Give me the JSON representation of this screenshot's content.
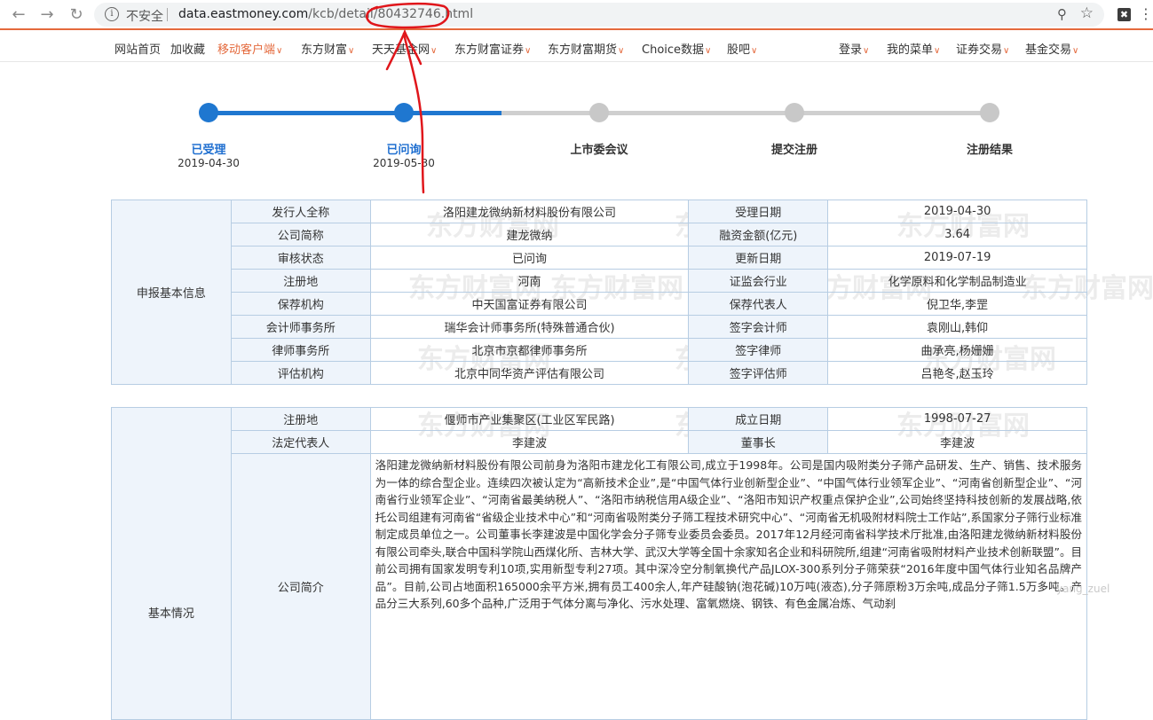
{
  "browser": {
    "insecure_label": "不安全",
    "url_host": "data.eastmoney.com",
    "url_path": "/kcb/detail/80432746.html"
  },
  "topnav": [
    {
      "label": "网站首页",
      "hl": false,
      "caret": false
    },
    {
      "label": "加收藏",
      "hl": false,
      "caret": false
    },
    {
      "label": "移动客户端",
      "hl": true,
      "caret": true
    },
    {
      "label": "东方财富",
      "hl": false,
      "caret": true
    },
    {
      "label": "天天基金网",
      "hl": false,
      "caret": true
    },
    {
      "label": "东方财富证券",
      "hl": false,
      "caret": true
    },
    {
      "label": "东方财富期货",
      "hl": false,
      "caret": true
    },
    {
      "label": "Choice数据",
      "hl": false,
      "caret": true
    },
    {
      "label": "股吧",
      "hl": false,
      "caret": true
    },
    {
      "label": "登录",
      "hl": false,
      "caret": true
    },
    {
      "label": "我的菜单",
      "hl": false,
      "caret": true
    },
    {
      "label": "证券交易",
      "hl": false,
      "caret": true
    },
    {
      "label": "基金交易",
      "hl": false,
      "caret": true
    }
  ],
  "steps": [
    {
      "label": "已受理",
      "date": "2019-04-30",
      "done": true
    },
    {
      "label": "已问询",
      "date": "2019-05-30",
      "done": true
    },
    {
      "label": "上市委会议",
      "date": "",
      "done": false
    },
    {
      "label": "提交注册",
      "date": "",
      "done": false
    },
    {
      "label": "注册结果",
      "date": "",
      "done": false
    }
  ],
  "basic_info": {
    "section": "申报基本信息",
    "rows": [
      [
        "发行人全称",
        "洛阳建龙微纳新材料股份有限公司",
        "受理日期",
        "2019-04-30"
      ],
      [
        "公司简称",
        "建龙微纳",
        "融资金额(亿元)",
        "3.64"
      ],
      [
        "审核状态",
        "已问询",
        "更新日期",
        "2019-07-19"
      ],
      [
        "注册地",
        "河南",
        "证监会行业",
        "化学原料和化学制品制造业"
      ],
      [
        "保荐机构",
        "中天国富证券有限公司",
        "保荐代表人",
        "倪卫华,李罡"
      ],
      [
        "会计师事务所",
        "瑞华会计师事务所(特殊普通合伙)",
        "签字会计师",
        "袁刚山,韩仰"
      ],
      [
        "律师事务所",
        "北京市京都律师事务所",
        "签字律师",
        "曲承亮,杨姗姗"
      ],
      [
        "评估机构",
        "北京中同华资产评估有限公司",
        "签字评估师",
        "吕艳冬,赵玉玲"
      ]
    ]
  },
  "company": {
    "section": "基本情况",
    "rows": [
      [
        "注册地",
        "偃师市产业集聚区(工业区军民路)",
        "成立日期",
        "1998-07-27"
      ],
      [
        "法定代表人",
        "李建波",
        "董事长",
        "李建波"
      ]
    ],
    "intro_label": "公司简介",
    "intro_text": "洛阳建龙微纳新材料股份有限公司前身为洛阳市建龙化工有限公司,成立于1998年。公司是国内吸附类分子筛产品研发、生产、销售、技术服务为一体的综合型企业。连续四次被认定为“高新技术企业”,是“中国气体行业创新型企业”、“中国气体行业领军企业”、“河南省创新型企业”、“河南省行业领军企业”、“河南省最美纳税人”、“洛阳市纳税信用A级企业”、“洛阳市知识产权重点保护企业”,公司始终坚持科技创新的发展战略,依托公司组建有河南省“省级企业技术中心”和“河南省吸附类分子筛工程技术研究中心”、“河南省无机吸附材料院士工作站”,系国家分子筛行业标准制定成员单位之一。公司董事长李建波是中国化学会分子筛专业委员会委员。2017年12月经河南省科学技术厅批准,由洛阳建龙微纳新材料股份有限公司牵头,联合中国科学院山西煤化所、吉林大学、武汉大学等全国十余家知名企业和科研院所,组建“河南省吸附材料产业技术创新联盟”。目前公司拥有国家发明专利10项,实用新型专利27项。其中深冷空分制氧换代产品JLOX-300系列分子筛荣获“2016年度中国气体行业知名品牌产品”。目前,公司占地面积165000余平方米,拥有员工400余人,年产硅酸钠(泡花碱)10万吨(液态),分子筛原粉3万余吨,成品分子筛1.5万多吨。产品分三大系列,60多个品种,广泛用于气体分离与净化、污水处理、富氧燃烧、钢铁、有色金属冶炼、气动刹"
  },
  "watermark": {
    "brand": "东方财富网",
    "domain": "eastmoney.com"
  },
  "credit": "yang_zuel",
  "colors": {
    "accent": "#e4693c",
    "progress": "#1f77d0",
    "annotation": "#e0161b"
  }
}
